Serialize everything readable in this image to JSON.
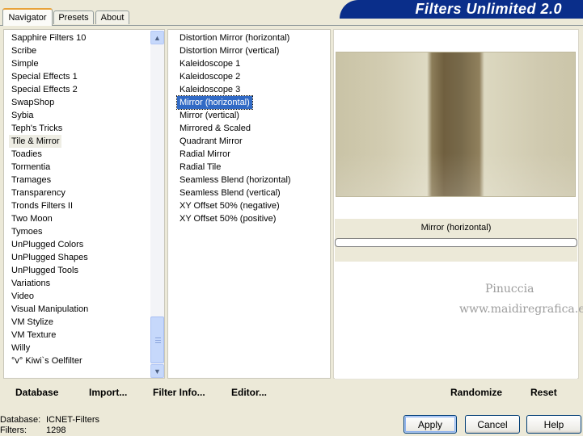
{
  "tabs": [
    {
      "label": "Navigator"
    },
    {
      "label": "Presets"
    },
    {
      "label": "About"
    }
  ],
  "banner": {
    "title": "Filters Unlimited 2.0",
    "color": "#0a2e8a"
  },
  "categories": [
    "Sapphire Filters 10",
    "Scribe",
    "Simple",
    "Special Effects 1",
    "Special Effects 2",
    "SwapShop",
    "Sybia",
    "Teph's Tricks",
    "Tile & Mirror",
    "Toadies",
    "Tormentia",
    "Tramages",
    "Transparency",
    "Tronds Filters II",
    "Two Moon",
    "Tymoes",
    "UnPlugged Colors",
    "UnPlugged Shapes",
    "UnPlugged Tools",
    "Variations",
    "Video",
    "Visual Manipulation",
    "VM Stylize",
    "VM Texture",
    "Willy",
    "°v° Kiwi`s Oelfilter"
  ],
  "selected_category": "Tile & Mirror",
  "filters": [
    "Distortion Mirror (horizontal)",
    "Distortion Mirror (vertical)",
    "Kaleidoscope 1",
    "Kaleidoscope 2",
    "Kaleidoscope 3",
    "Mirror (horizontal)",
    "Mirror (vertical)",
    "Mirrored & Scaled",
    "Quadrant Mirror",
    "Radial Mirror",
    "Radial Tile",
    "Seamless Blend (horizontal)",
    "Seamless Blend (vertical)",
    "XY Offset 50% (negative)",
    "XY Offset 50% (positive)"
  ],
  "selected_filter": "Mirror (horizontal)",
  "preview": {
    "filter_name": "Mirror (horizontal)"
  },
  "watermark": {
    "line1": "Pinuccia",
    "line2": "www.maidiregrafica.eu"
  },
  "toolbar": {
    "database": "Database",
    "import": "Import...",
    "filter_info": "Filter Info...",
    "editor": "Editor...",
    "randomize": "Randomize",
    "reset": "Reset"
  },
  "status": {
    "database_label": "Database:",
    "database_value": "ICNET-Filters",
    "filters_label": "Filters:",
    "filters_value": "1298"
  },
  "buttons": {
    "apply": "Apply",
    "cancel": "Cancel",
    "help": "Help"
  },
  "colors": {
    "selection": "#316ac5",
    "dialog_bg": "#ece9d8",
    "tab_accent": "#e8a23a"
  }
}
